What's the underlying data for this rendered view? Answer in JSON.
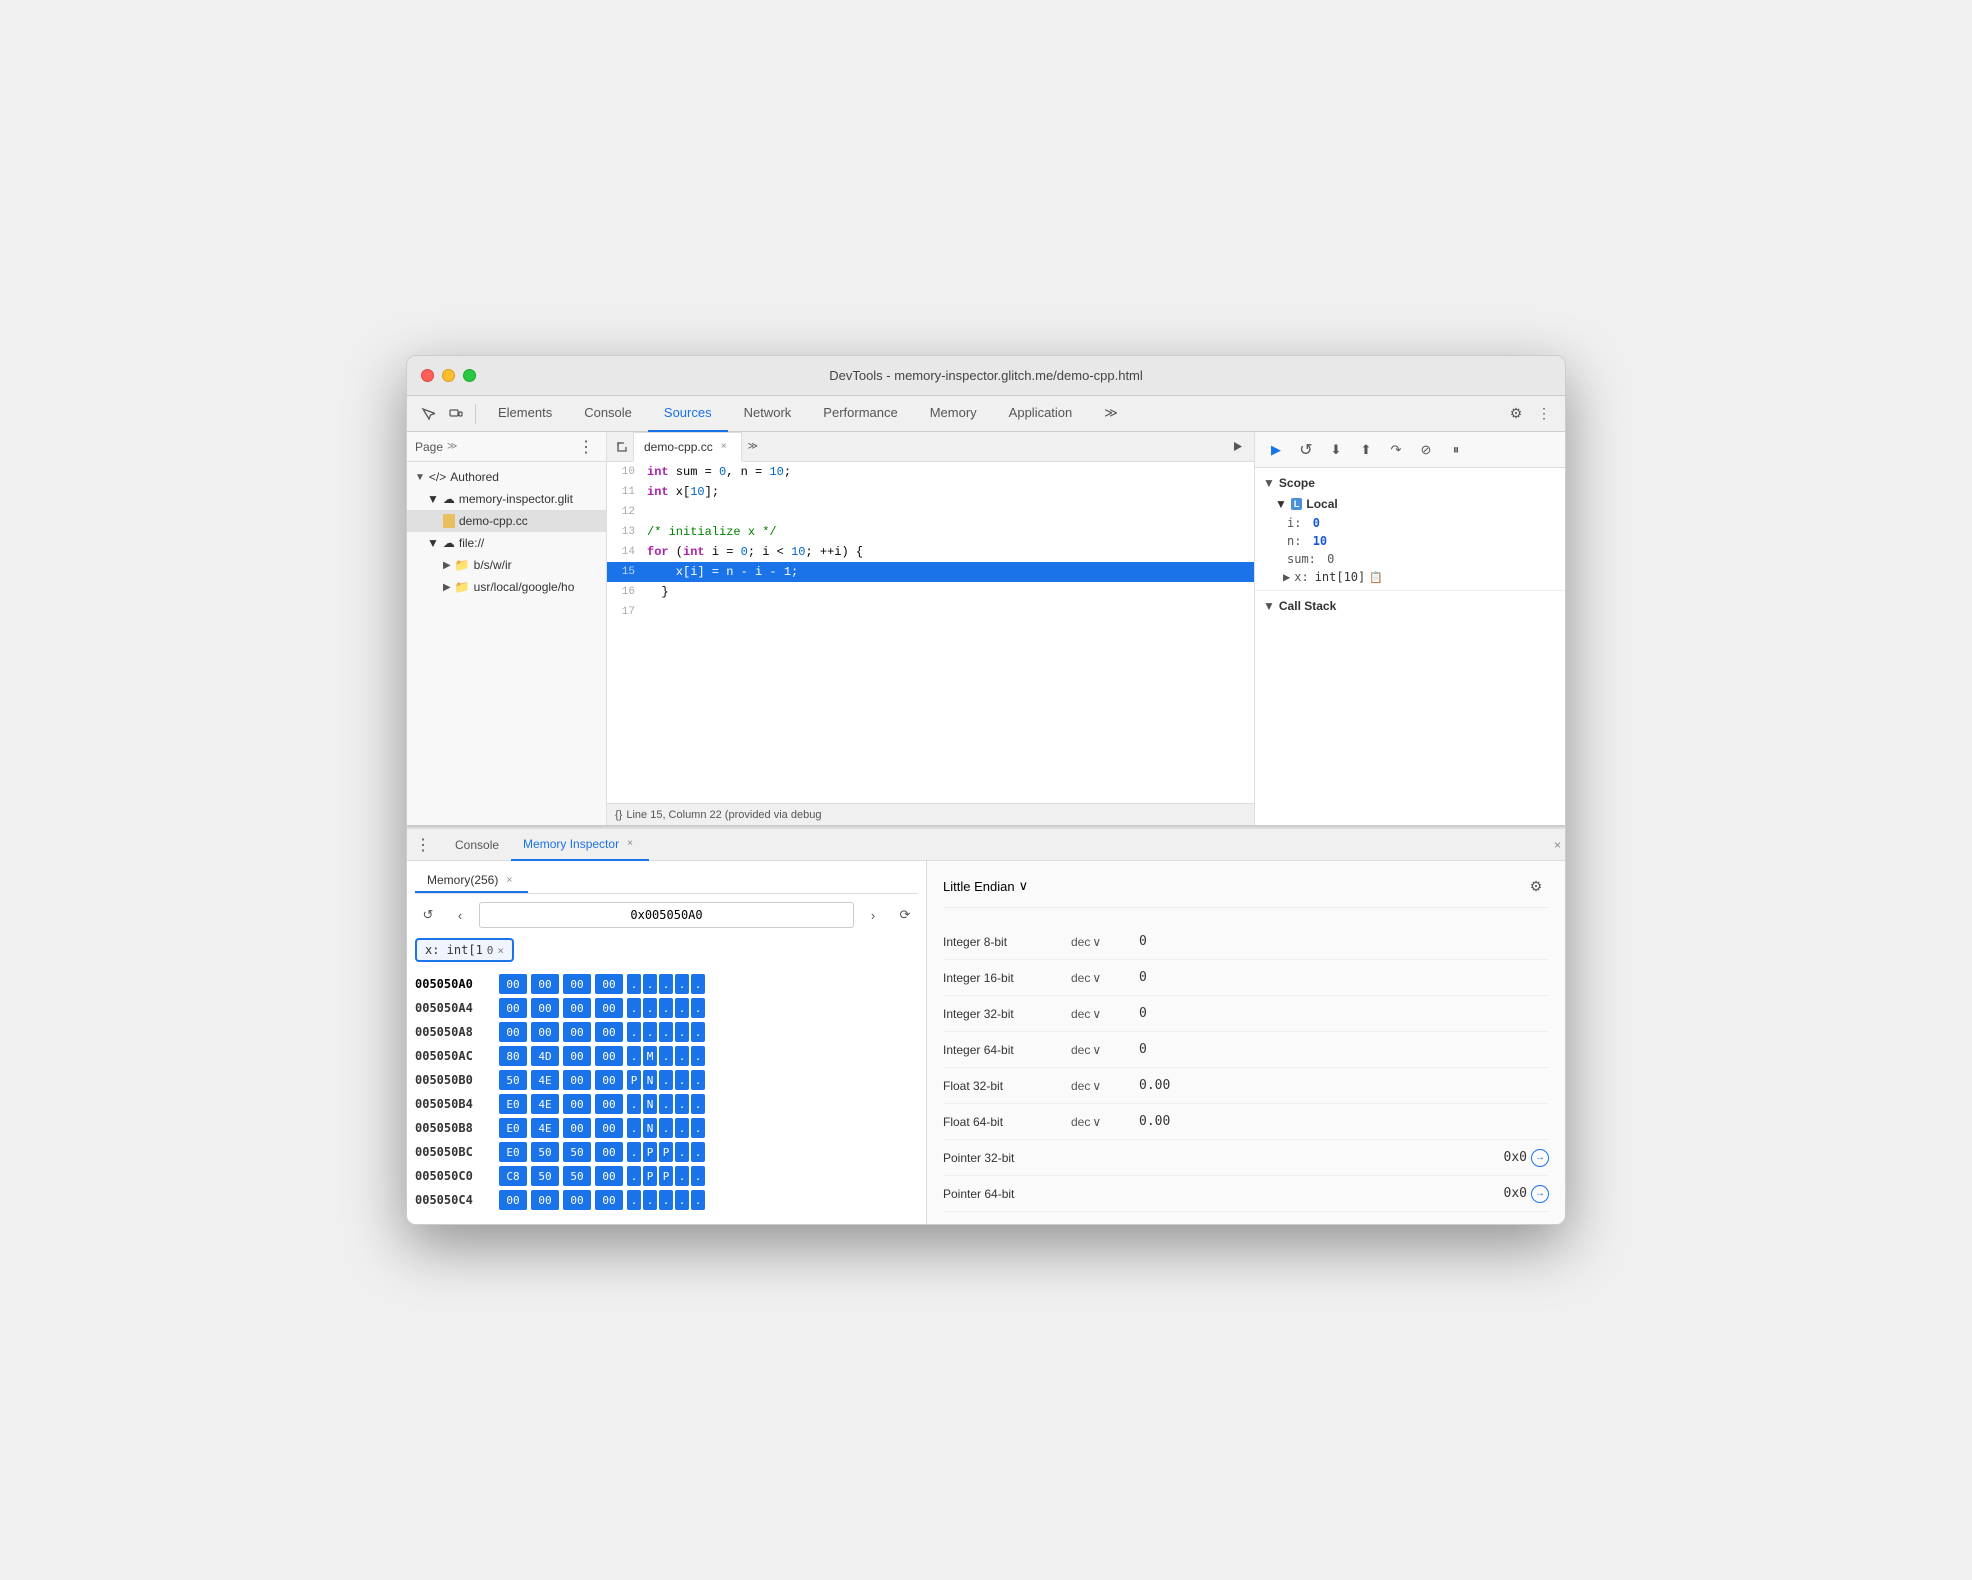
{
  "window": {
    "title": "DevTools - memory-inspector.glitch.me/demo-cpp.html"
  },
  "titlebar": {
    "close": "×",
    "minimize": "−",
    "maximize": "+"
  },
  "devtools_nav": {
    "tabs": [
      "Elements",
      "Console",
      "Sources",
      "Network",
      "Performance",
      "Memory",
      "Application"
    ],
    "active_tab": "Sources",
    "more_icon": "≫",
    "settings_icon": "⚙",
    "more_vertical_icon": "⋮"
  },
  "file_panel": {
    "page_label": "Page",
    "more_icon": "≫",
    "three_dots": "⋮",
    "tree": [
      {
        "label": "</> Authored",
        "level": 0,
        "type": "section"
      },
      {
        "label": "memory-inspector.glit",
        "level": 1,
        "type": "cloud"
      },
      {
        "label": "demo-cpp.cc",
        "level": 2,
        "type": "file"
      },
      {
        "label": "file://",
        "level": 1,
        "type": "cloud"
      },
      {
        "label": "b/s/w/ir",
        "level": 2,
        "type": "folder"
      },
      {
        "label": "usr/local/google/ho",
        "level": 2,
        "type": "folder"
      }
    ]
  },
  "code_editor": {
    "filename": "demo-cpp.cc",
    "tab_close": "×",
    "more_icon": "≫",
    "lines": [
      {
        "num": 10,
        "tokens": [
          {
            "type": "kw",
            "text": "int"
          },
          {
            "type": "normal",
            "text": " sum = "
          },
          {
            "type": "num",
            "text": "0"
          },
          {
            "type": "normal",
            "text": ", n = "
          },
          {
            "type": "num",
            "text": "10"
          },
          {
            "type": "normal",
            "text": ";"
          }
        ],
        "active": false
      },
      {
        "num": 11,
        "tokens": [
          {
            "type": "kw",
            "text": "int"
          },
          {
            "type": "normal",
            "text": " x["
          },
          {
            "type": "num",
            "text": "10"
          },
          {
            "type": "normal",
            "text": "];"
          }
        ],
        "active": false
      },
      {
        "num": 12,
        "tokens": [],
        "active": false
      },
      {
        "num": 13,
        "tokens": [
          {
            "type": "cm",
            "text": "/* initialize x */"
          }
        ],
        "active": false
      },
      {
        "num": 14,
        "tokens": [
          {
            "type": "kw",
            "text": "for"
          },
          {
            "type": "normal",
            "text": " ("
          },
          {
            "type": "kw",
            "text": "int"
          },
          {
            "type": "normal",
            "text": " i = "
          },
          {
            "type": "num",
            "text": "0"
          },
          {
            "type": "normal",
            "text": "; i < "
          },
          {
            "type": "num",
            "text": "10"
          },
          {
            "type": "normal",
            "text": "; ++i) {"
          }
        ],
        "active": false
      },
      {
        "num": 15,
        "tokens": [
          {
            "type": "normal",
            "text": "    x[i] = n - i - 1;"
          }
        ],
        "active": true
      },
      {
        "num": 16,
        "tokens": [
          {
            "type": "normal",
            "text": "  }"
          }
        ],
        "active": false
      },
      {
        "num": 17,
        "tokens": [],
        "active": false
      }
    ],
    "status": "Line 15, Column 22 (provided via debug"
  },
  "debug_toolbar": {
    "buttons": [
      "▶",
      "↺",
      "⬇",
      "⬆",
      "↷",
      "⊘",
      "⏸"
    ]
  },
  "scope": {
    "header": "Scope",
    "local_label": "Local",
    "local_badge": "L",
    "items": [
      {
        "key": "i:",
        "value": "0",
        "type": "num"
      },
      {
        "key": "n:",
        "value": "10",
        "type": "num"
      },
      {
        "key": "sum:",
        "value": "0",
        "type": "zero"
      },
      {
        "key": "▶ x:",
        "value": "int[10]",
        "type": "arr"
      }
    ],
    "callstack_header": "Call Stack"
  },
  "bottom_panel": {
    "console_tab": "Console",
    "memory_tab": "Memory Inspector",
    "memory_tab_close": "×",
    "close_panel": "×"
  },
  "memory_subtab": {
    "label": "Memory(256)",
    "close": "×"
  },
  "memory_nav": {
    "back": "↺",
    "prev": "‹",
    "address": "0x005050A0",
    "next": "›",
    "refresh": "⟳"
  },
  "highlight_badge": {
    "label": "x: int[1",
    "close": "×"
  },
  "hex_rows": [
    {
      "addr": "005050A0",
      "current": true,
      "bytes": [
        "00",
        "00",
        "00",
        "00"
      ],
      "ascii": [
        ".",
        ".",
        ".",
        ".",
        "."
      ]
    },
    {
      "addr": "005050A4",
      "bytes": [
        "00",
        "00",
        "00",
        "00"
      ],
      "ascii": [
        ".",
        ".",
        ".",
        ".",
        "."
      ]
    },
    {
      "addr": "005050A8",
      "bytes": [
        "00",
        "00",
        "00",
        "00"
      ],
      "ascii": [
        ".",
        ".",
        ".",
        ".",
        "."
      ]
    },
    {
      "addr": "005050AC",
      "bytes": [
        "80",
        "4D",
        "00",
        "00"
      ],
      "ascii": [
        ".",
        "M",
        ".",
        "."
      ]
    },
    {
      "addr": "005050B0",
      "bytes": [
        "50",
        "4E",
        "00",
        "00"
      ],
      "ascii": [
        "P",
        "N",
        ".",
        "."
      ]
    },
    {
      "addr": "005050B4",
      "bytes": [
        "E0",
        "4E",
        "00",
        "00"
      ],
      "ascii": [
        ".",
        "N",
        ".",
        "."
      ]
    },
    {
      "addr": "005050B8",
      "bytes": [
        "E0",
        "4E",
        "00",
        "00"
      ],
      "ascii": [
        ".",
        "N",
        ".",
        "."
      ]
    },
    {
      "addr": "005050BC",
      "bytes": [
        "E0",
        "50",
        "50",
        "00"
      ],
      "ascii": [
        ".",
        "P",
        "P",
        "."
      ]
    },
    {
      "addr": "005050C0",
      "bytes": [
        "C8",
        "50",
        "50",
        "00"
      ],
      "ascii": [
        ".",
        "P",
        "P",
        "."
      ]
    },
    {
      "addr": "005050C4",
      "bytes": [
        "00",
        "00",
        "00",
        "00"
      ],
      "ascii": [
        ".",
        ".",
        ".",
        "."
      ]
    }
  ],
  "value_inspector": {
    "endian": "Little Endian",
    "gear_icon": "⚙",
    "rows": [
      {
        "type": "Integer 8-bit",
        "format": "dec",
        "value": "0",
        "link": false
      },
      {
        "type": "Integer 16-bit",
        "format": "dec",
        "value": "0",
        "link": false
      },
      {
        "type": "Integer 32-bit",
        "format": "dec",
        "value": "0",
        "link": false
      },
      {
        "type": "Integer 64-bit",
        "format": "dec",
        "value": "0",
        "link": false
      },
      {
        "type": "Float 32-bit",
        "format": "dec",
        "value": "0.00",
        "link": false
      },
      {
        "type": "Float 64-bit",
        "format": "dec",
        "value": "0.00",
        "link": false
      },
      {
        "type": "Pointer 32-bit",
        "format": "",
        "value": "0x0",
        "link": true
      },
      {
        "type": "Pointer 64-bit",
        "format": "",
        "value": "0x0",
        "link": true
      }
    ]
  }
}
